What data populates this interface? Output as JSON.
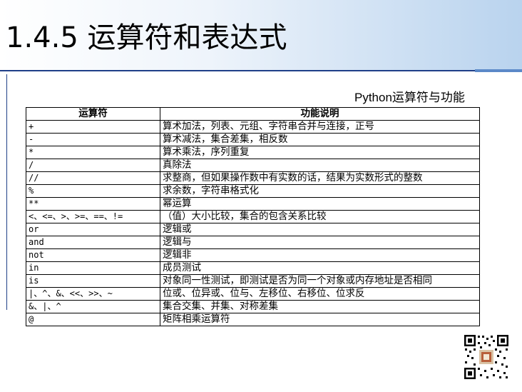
{
  "slide": {
    "title": "1.4.5  运算符和表达式",
    "caption": "Python运算符与功能"
  },
  "table": {
    "headers": [
      "运算符",
      "功能说明"
    ],
    "rows": [
      {
        "op": "+",
        "desc": "算术加法，列表、元组、字符串合并与连接，正号"
      },
      {
        "op": "-",
        "desc": "算术减法，集合差集，相反数"
      },
      {
        "op": "*",
        "desc": "算术乘法，序列重复"
      },
      {
        "op": "/",
        "desc": "真除法"
      },
      {
        "op": "//",
        "desc": "求整商，但如果操作数中有实数的话，结果为实数形式的整数"
      },
      {
        "op": "%",
        "desc": "求余数，字符串格式化"
      },
      {
        "op": "**",
        "desc": "幂运算"
      },
      {
        "op": "<、<=、>、>=、==、!=",
        "desc": "（值）大小比较，集合的包含关系比较"
      },
      {
        "op": "or",
        "desc": "逻辑或"
      },
      {
        "op": "and",
        "desc": "逻辑与"
      },
      {
        "op": "not",
        "desc": "逻辑非"
      },
      {
        "op": "in",
        "desc": "成员测试"
      },
      {
        "op": "is",
        "desc": "对象同一性测试，即测试是否为同一个对象或内存地址是否相同"
      },
      {
        "op": "|、^、&、<<、>>、~",
        "desc": "位或、位异或、位与、左移位、右移位、位求反"
      },
      {
        "op": "&、|、^",
        "desc": "集合交集、并集、对称差集"
      },
      {
        "op": "@",
        "desc": "矩阵相乘运算符"
      }
    ]
  },
  "colors": {
    "header_gradient_end": "#b9d3ee",
    "rule": "#1f3f88"
  },
  "icons": {
    "qr": "qr-code-icon"
  }
}
